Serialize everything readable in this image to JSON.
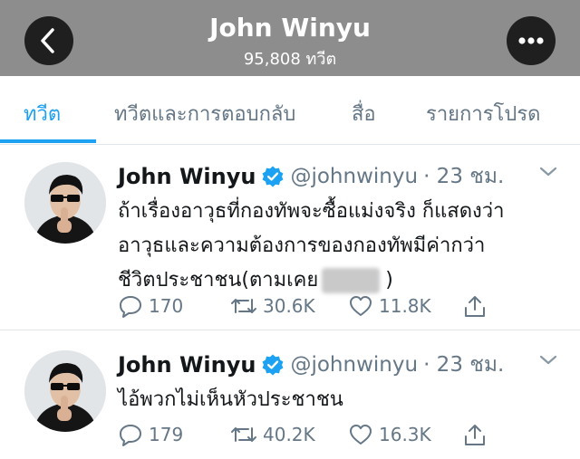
{
  "header": {
    "name": "John Winyu",
    "tweet_count": "95,808 ทวีต",
    "back_icon": "back-chevron-icon",
    "more_icon": "ellipsis-icon",
    "bar_color": "#8d8d8d"
  },
  "tabs": [
    {
      "label": "ทวีต",
      "active": true
    },
    {
      "label": "ทวีตและการตอบกลับ",
      "active": false
    },
    {
      "label": "สื่อ",
      "active": false
    },
    {
      "label": "รายการโปรด",
      "active": false
    }
  ],
  "accent_color": "#1da1f2",
  "tweets": [
    {
      "name": "John Winyu",
      "handle": "@johnwinyu",
      "time": "· 23 ชม.",
      "lines": [
        "ถ้าเรื่องอาวุธที่กองทัพจะซื้อแม่งจริง ก็แสดงว่า",
        "อาวุธและความต้องการของกองทัพมีค่ากว่า",
        "ชีวิตประชาชน(ตามเคย",
        ")"
      ],
      "replies": "170",
      "retweets": "30.6K",
      "likes": "11.8K"
    },
    {
      "name": "John Winyu",
      "handle": "@johnwinyu",
      "time": "· 23 ชม.",
      "lines": [
        "ไอ้พวกไม่เห็นหัวประชาชน"
      ],
      "replies": "179",
      "retweets": "40.2K",
      "likes": "16.3K"
    }
  ]
}
